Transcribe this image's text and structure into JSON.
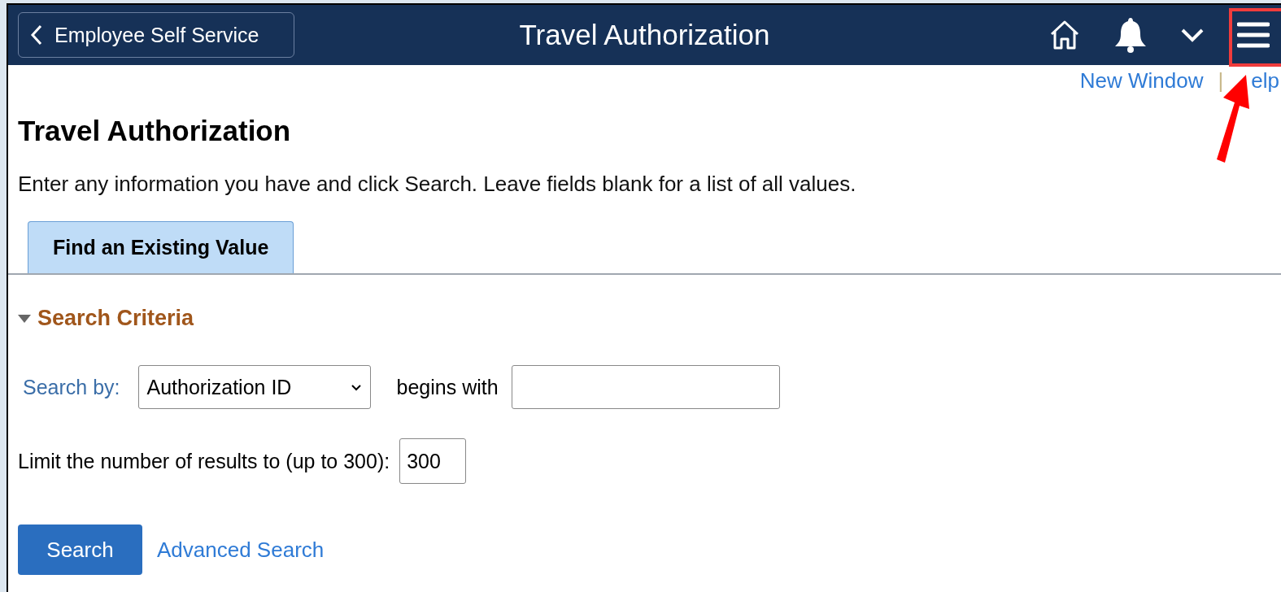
{
  "header": {
    "back_button": "Employee Self Service",
    "title": "Travel Authorization"
  },
  "links": [
    "New Window",
    "elp"
  ],
  "link_separator": "|",
  "page_title": "Travel Authorization",
  "instructions": "Enter any information you have and click Search. Leave fields blank for a list of all values.",
  "tabs": [
    {
      "label": "Find an Existing Value",
      "selected": true
    }
  ],
  "section": {
    "title": "Search Criteria",
    "expanded": true
  },
  "search_by": {
    "label": "Search by:",
    "value": "Authorization ID",
    "operator": "begins with"
  },
  "limit": {
    "label": "Limit the number of results to (up to 300):",
    "value": "300"
  },
  "search_button": "Search",
  "advanced_link": "Advanced Search",
  "annotations": [
    {
      "kind": "box",
      "color": "#f03c3c"
    },
    {
      "kind": "arrow",
      "color": "#ff0000"
    }
  ]
}
